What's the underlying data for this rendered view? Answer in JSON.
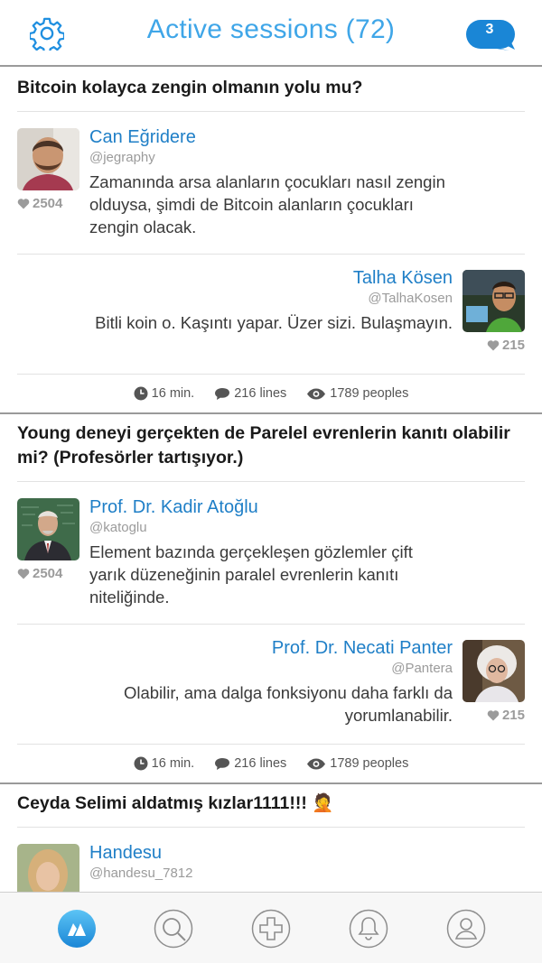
{
  "header": {
    "title": "Active sessions (72)",
    "notifications_count": "3",
    "settings_icon": "gear-icon",
    "notification_icon": "speech-bubble-icon"
  },
  "colors": {
    "accent": "#3fa6e8",
    "name": "#1f7fc7",
    "badge": "#1a86d6",
    "muted": "#9b9b9b"
  },
  "sessions": [
    {
      "title": "Bitcoin kolayca zengin olmanın yolu mu?",
      "left": {
        "name": "Can Eğridere",
        "handle": "@jegraphy",
        "text": "Zamanında arsa alanların çocukları nasıl zengin olduysa, şimdi de Bitcoin alanların çocukları zengin olacak.",
        "likes": "2504"
      },
      "right": {
        "name": "Talha Kösen",
        "handle": "@TalhaKosen",
        "text": "Bitli koin o. Kaşıntı yapar. Üzer sizi. Bulaşmayın.",
        "likes": "215"
      },
      "stats": {
        "duration": "16 min.",
        "lines": "216 lines",
        "peoples": "1789 peoples"
      }
    },
    {
      "title": "Young deneyi gerçekten de Parelel evrenlerin kanıtı olabilir mi? (Profesörler tartışıyor.)",
      "left": {
        "name": "Prof. Dr. Kadir Atoğlu",
        "handle": "@katoglu",
        "text": "Element bazında gerçekleşen gözlemler çift yarık düzeneğinin paralel evrenlerin kanıtı niteliğinde.",
        "likes": "2504"
      },
      "right": {
        "name": "Prof. Dr. Necati Panter",
        "handle": "@Pantera",
        "text": "Olabilir, ama dalga fonksiyonu daha farklı da yorumlanabilir.",
        "likes": "215"
      },
      "stats": {
        "duration": "16 min.",
        "lines": "216 lines",
        "peoples": "1789 peoples"
      }
    },
    {
      "title": "Ceyda Selimi aldatmış kızlar1111!!! 🤦",
      "left": {
        "name": "Handesu",
        "handle": "@handesu_7812"
      }
    }
  ],
  "tabbar": {
    "items": [
      "home-logo-icon",
      "search-icon",
      "add-icon",
      "bell-icon",
      "profile-icon"
    ],
    "active": "home-logo-icon"
  }
}
